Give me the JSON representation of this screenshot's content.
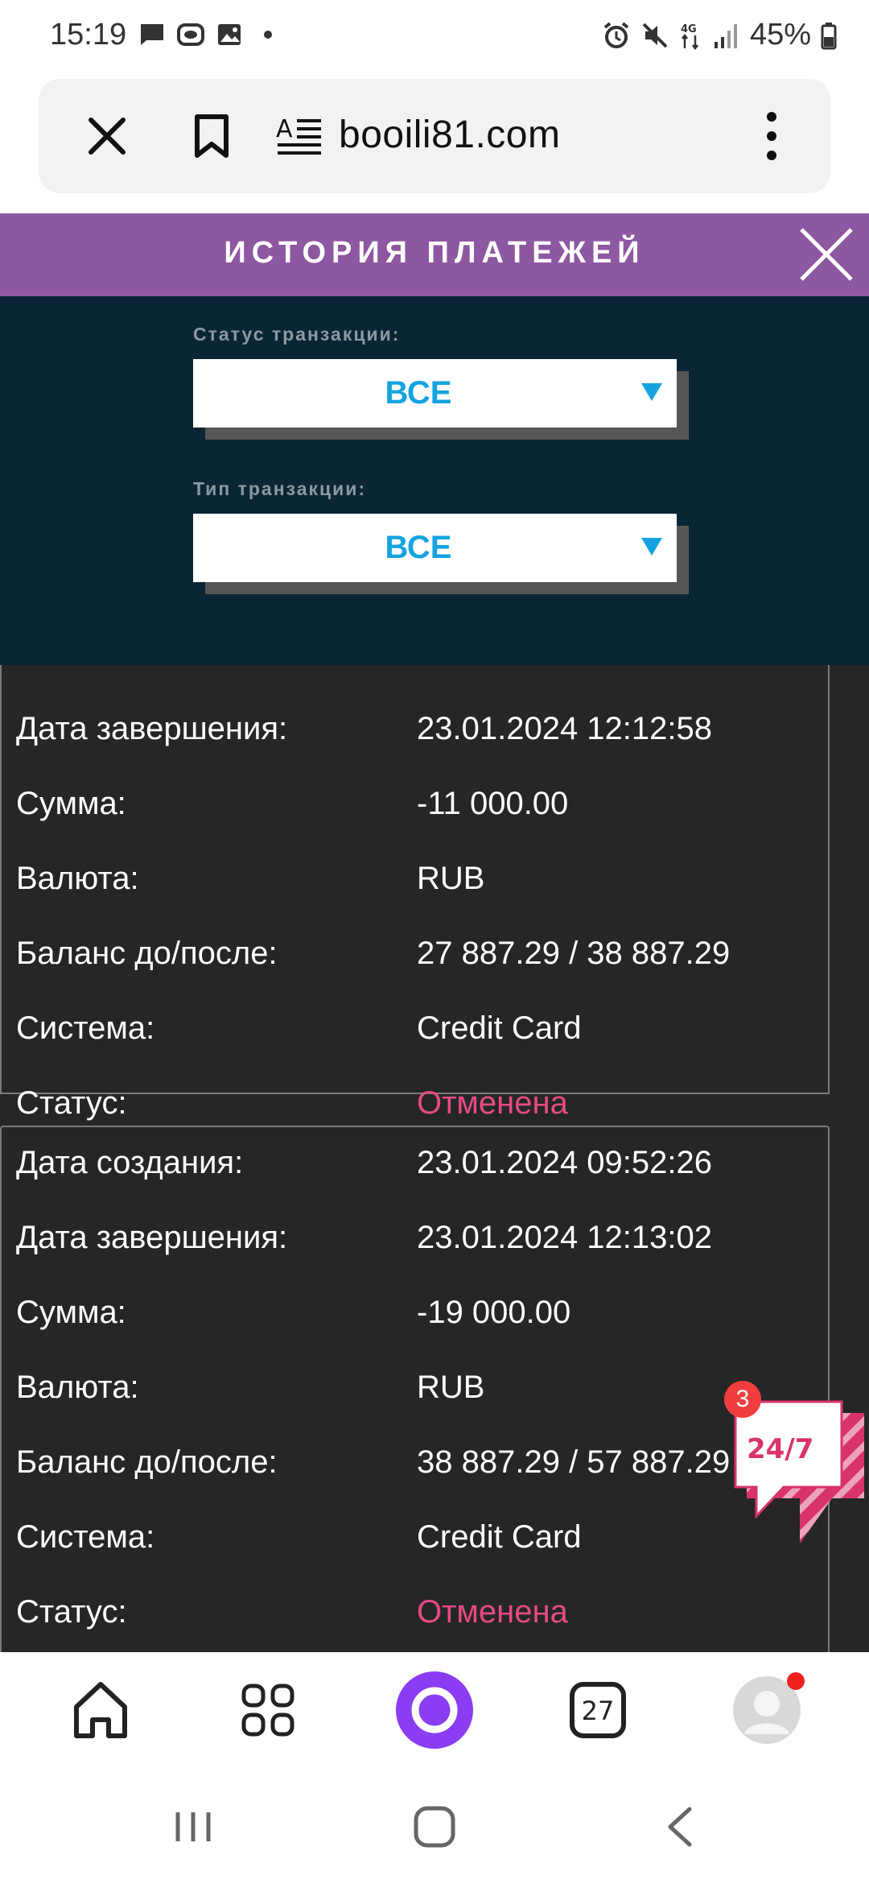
{
  "status_bar": {
    "time": "15:19",
    "battery": "45%",
    "left_icons": [
      "message-icon",
      "chat-bubble-icon",
      "image-icon",
      "dot-icon"
    ],
    "right_icons": [
      "alarm-icon",
      "mute-icon",
      "4g-icon",
      "signal-icon",
      "battery-icon"
    ]
  },
  "browser": {
    "url": "booili81.com",
    "icons": [
      "close-icon",
      "bookmark-icon",
      "reader-mode-icon",
      "more-vert-icon"
    ]
  },
  "modal": {
    "title": "ИСТОРИЯ ПЛАТЕЖЕЙ",
    "filters": [
      {
        "label": "Статус транзакции:",
        "value": "ВСЕ"
      },
      {
        "label": "Тип транзакции:",
        "value": "ВСЕ"
      }
    ]
  },
  "transactions": [
    {
      "rows": [
        {
          "label": "Дата завершения:",
          "value": "23.01.2024 12:12:58"
        },
        {
          "label": "Сумма:",
          "value": "-11 000.00"
        },
        {
          "label": "Валюта:",
          "value": "RUB"
        },
        {
          "label": "Баланс до/после:",
          "value": "27 887.29 / 38 887.29"
        },
        {
          "label": "Система:",
          "value": "Credit Card"
        },
        {
          "label": "Статус:",
          "value": "Отменена"
        }
      ]
    },
    {
      "rows": [
        {
          "label": "Дата создания:",
          "value": "23.01.2024 09:52:26"
        },
        {
          "label": "Дата завершения:",
          "value": "23.01.2024 12:13:02"
        },
        {
          "label": "Сумма:",
          "value": "-19 000.00"
        },
        {
          "label": "Валюта:",
          "value": "RUB"
        },
        {
          "label": "Баланс до/после:",
          "value": "38 887.29 / 57 887.29"
        },
        {
          "label": "Система:",
          "value": "Credit Card"
        },
        {
          "label": "Статус:",
          "value": "Отменена"
        }
      ]
    }
  ],
  "chat_widget": {
    "label": "24/7",
    "badge": "3"
  },
  "bottom_nav": {
    "tabs_count": "27",
    "items": [
      "home-icon",
      "apps-grid-icon",
      "alice-assistant-icon",
      "tabs-icon",
      "profile-avatar"
    ]
  },
  "system_nav": [
    "recents-icon",
    "home-circle-icon",
    "back-icon"
  ],
  "colors": {
    "modal_header": "#8e57a1",
    "filter_panel": "#0a2635",
    "select_text": "#14a3e0",
    "page_bg": "#262626",
    "status_cancelled": "#e64a84",
    "alice_purple": "#8a3df2"
  }
}
